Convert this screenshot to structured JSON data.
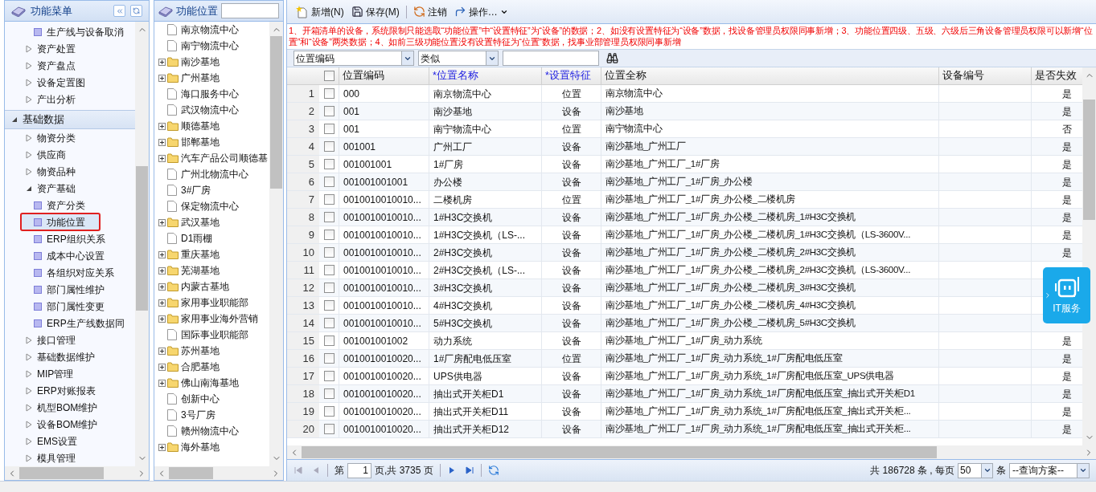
{
  "menu": {
    "title": "功能菜单",
    "items": [
      {
        "label": "生产线与设备取消",
        "kind": "leaf",
        "selected": false
      },
      {
        "label": "资产处置",
        "kind": "group",
        "expanded": false
      },
      {
        "label": "资产盘点",
        "kind": "group",
        "expanded": false
      },
      {
        "label": "设备定置图",
        "kind": "group",
        "expanded": false
      },
      {
        "label": "产出分析",
        "kind": "group",
        "expanded": false
      }
    ],
    "section": {
      "label": "基础数据",
      "expanded": true,
      "children": [
        {
          "label": "物资分类",
          "kind": "group",
          "expanded": false
        },
        {
          "label": "供应商",
          "kind": "group",
          "expanded": false
        },
        {
          "label": "物资品种",
          "kind": "group",
          "expanded": false
        },
        {
          "label": "资产基础",
          "kind": "group",
          "expanded": true,
          "children": [
            {
              "label": "资产分类",
              "kind": "leaf",
              "selected": false
            },
            {
              "label": "功能位置",
              "kind": "leaf",
              "selected": true
            },
            {
              "label": "ERP组织关系",
              "kind": "leaf",
              "selected": false
            },
            {
              "label": "成本中心设置",
              "kind": "leaf",
              "selected": false
            },
            {
              "label": "各组织对应关系",
              "kind": "leaf",
              "selected": false
            },
            {
              "label": "部门属性维护",
              "kind": "leaf",
              "selected": false
            },
            {
              "label": "部门属性变更",
              "kind": "leaf",
              "selected": false
            },
            {
              "label": "ERP生产线数据同",
              "kind": "leaf",
              "selected": false
            }
          ]
        },
        {
          "label": "接口管理",
          "kind": "group",
          "expanded": false
        },
        {
          "label": "基础数据维护",
          "kind": "group",
          "expanded": false
        },
        {
          "label": "MIP管理",
          "kind": "group",
          "expanded": false
        },
        {
          "label": "ERP对账报表",
          "kind": "group",
          "expanded": false
        },
        {
          "label": "机型BOM维护",
          "kind": "group",
          "expanded": false
        },
        {
          "label": "设备BOM维护",
          "kind": "group",
          "expanded": false
        },
        {
          "label": "EMS设置",
          "kind": "group",
          "expanded": false
        },
        {
          "label": "模具管理",
          "kind": "group",
          "expanded": false
        }
      ]
    }
  },
  "location_tree": {
    "title": "功能位置",
    "nodes": [
      {
        "label": "南京物流中心",
        "kind": "file"
      },
      {
        "label": "南宁物流中心",
        "kind": "file"
      },
      {
        "label": "南沙基地",
        "kind": "folder",
        "expanded": false
      },
      {
        "label": "广州基地",
        "kind": "folder",
        "expanded": false
      },
      {
        "label": "海口服务中心",
        "kind": "file"
      },
      {
        "label": "武汉物流中心",
        "kind": "file"
      },
      {
        "label": "顺德基地",
        "kind": "folder",
        "expanded": false
      },
      {
        "label": "邯郸基地",
        "kind": "folder",
        "expanded": false
      },
      {
        "label": "汽车产品公司顺德基",
        "kind": "folder",
        "expanded": false
      },
      {
        "label": "广州北物流中心",
        "kind": "file"
      },
      {
        "label": "3#厂房",
        "kind": "file"
      },
      {
        "label": "保定物流中心",
        "kind": "file"
      },
      {
        "label": "武汉基地",
        "kind": "folder",
        "expanded": false
      },
      {
        "label": "D1雨棚",
        "kind": "file"
      },
      {
        "label": "重庆基地",
        "kind": "folder",
        "expanded": false
      },
      {
        "label": "芜湖基地",
        "kind": "folder",
        "expanded": false
      },
      {
        "label": "内蒙古基地",
        "kind": "folder",
        "expanded": false
      },
      {
        "label": "家用事业职能部",
        "kind": "folder",
        "expanded": false
      },
      {
        "label": "家用事业海外营销",
        "kind": "folder",
        "expanded": false
      },
      {
        "label": "国际事业职能部",
        "kind": "file"
      },
      {
        "label": "苏州基地",
        "kind": "folder",
        "expanded": false
      },
      {
        "label": "合肥基地",
        "kind": "folder",
        "expanded": false
      },
      {
        "label": "佛山南海基地",
        "kind": "folder",
        "expanded": false
      },
      {
        "label": "创新中心",
        "kind": "file"
      },
      {
        "label": "3号厂房",
        "kind": "file"
      },
      {
        "label": "赣州物流中心",
        "kind": "file"
      },
      {
        "label": "海外基地",
        "kind": "folder",
        "expanded": false
      }
    ]
  },
  "toolbar": [
    {
      "label": "新增(N)",
      "kind": "new"
    },
    {
      "label": "保存(M)",
      "kind": "save"
    },
    {
      "label": "注销",
      "kind": "cancel"
    },
    {
      "label": "操作…",
      "kind": "menu"
    }
  ],
  "notice": "1、开箱清单的设备，系统限制只能选取“功能位置”中“设置特征”为“设备”的数据；2、如没有设置特征为“设备”数据，找设备管理员权限同事新增；3、功能位置四级、五级、六级后三角设备管理员权限可以新增“位置”和“设备”两类数据；4、如前三级功能位置没有设置特征为“位置”数据，找事业部管理员权限同事新增",
  "filter": {
    "field": "位置编码",
    "operator": "类似"
  },
  "table": {
    "all_checked": false,
    "columns": [
      {
        "label": "位置编码",
        "required": false
      },
      {
        "label": "*位置名称",
        "required": true
      },
      {
        "label": "*设置特征",
        "required": true
      },
      {
        "label": "位置全称",
        "required": false
      },
      {
        "label": "设备编号",
        "required": false
      },
      {
        "label": "是否失效",
        "required": false
      }
    ],
    "rows": [
      {
        "no": "1",
        "checked": false,
        "code": "000",
        "name": "南京物流中心",
        "feature": "位置",
        "full_name": "南京物流中心",
        "invalid": "是"
      },
      {
        "no": "2",
        "checked": false,
        "code": "001",
        "name": "南沙基地",
        "feature": "设备",
        "full_name": "南沙基地",
        "invalid": "是"
      },
      {
        "no": "3",
        "checked": false,
        "code": "001",
        "name": "南宁物流中心",
        "feature": "位置",
        "full_name": "南宁物流中心",
        "invalid": "否"
      },
      {
        "no": "4",
        "checked": false,
        "code": "001001",
        "name": "广州工厂",
        "feature": "设备",
        "full_name": "南沙基地_广州工厂",
        "invalid": "是"
      },
      {
        "no": "5",
        "checked": false,
        "code": "001001001",
        "name": "1#厂房",
        "feature": "设备",
        "full_name": "南沙基地_广州工厂_1#厂房",
        "invalid": "是"
      },
      {
        "no": "6",
        "checked": false,
        "code": "001001001001",
        "name": "办公楼",
        "feature": "设备",
        "full_name": "南沙基地_广州工厂_1#厂房_办公楼",
        "invalid": "是"
      },
      {
        "no": "7",
        "checked": false,
        "code": "0010010010010...",
        "name": "二楼机房",
        "feature": "位置",
        "full_name": "南沙基地_广州工厂_1#厂房_办公楼_二楼机房",
        "invalid": "是"
      },
      {
        "no": "8",
        "checked": false,
        "code": "0010010010010...",
        "name": "1#H3C交换机",
        "feature": "设备",
        "full_name": "南沙基地_广州工厂_1#厂房_办公楼_二楼机房_1#H3C交换机",
        "invalid": "是"
      },
      {
        "no": "9",
        "checked": false,
        "code": "0010010010010...",
        "name": "1#H3C交换机（LS-...",
        "feature": "设备",
        "full_name": "南沙基地_广州工厂_1#厂房_办公楼_二楼机房_1#H3C交换机（LS-3600V...",
        "invalid": "是"
      },
      {
        "no": "10",
        "checked": false,
        "code": "0010010010010...",
        "name": "2#H3C交换机",
        "feature": "设备",
        "full_name": "南沙基地_广州工厂_1#厂房_办公楼_二楼机房_2#H3C交换机",
        "invalid": "是"
      },
      {
        "no": "11",
        "checked": false,
        "code": "0010010010010...",
        "name": "2#H3C交换机（LS-...",
        "feature": "设备",
        "full_name": "南沙基地_广州工厂_1#厂房_办公楼_二楼机房_2#H3C交换机（LS-3600V..."
      },
      {
        "no": "12",
        "checked": false,
        "code": "0010010010010...",
        "name": "3#H3C交换机",
        "feature": "设备",
        "full_name": "南沙基地_广州工厂_1#厂房_办公楼_二楼机房_3#H3C交换机"
      },
      {
        "no": "13",
        "checked": false,
        "code": "0010010010010...",
        "name": "4#H3C交换机",
        "feature": "设备",
        "full_name": "南沙基地_广州工厂_1#厂房_办公楼_二楼机房_4#H3C交换机"
      },
      {
        "no": "14",
        "checked": false,
        "code": "0010010010010...",
        "name": "5#H3C交换机",
        "feature": "设备",
        "full_name": "南沙基地_广州工厂_1#厂房_办公楼_二楼机房_5#H3C交换机"
      },
      {
        "no": "15",
        "checked": false,
        "code": "001001001002",
        "name": "动力系统",
        "feature": "设备",
        "full_name": "南沙基地_广州工厂_1#厂房_动力系统",
        "invalid": "是"
      },
      {
        "no": "16",
        "checked": false,
        "code": "0010010010020...",
        "name": "1#厂房配电低压室",
        "feature": "位置",
        "full_name": "南沙基地_广州工厂_1#厂房_动力系统_1#厂房配电低压室",
        "invalid": "是"
      },
      {
        "no": "17",
        "checked": false,
        "code": "0010010010020...",
        "name": "UPS供电器",
        "feature": "设备",
        "full_name": "南沙基地_广州工厂_1#厂房_动力系统_1#厂房配电低压室_UPS供电器",
        "invalid": "是"
      },
      {
        "no": "18",
        "checked": false,
        "code": "0010010010020...",
        "name": "抽出式开关柜D1",
        "feature": "设备",
        "full_name": "南沙基地_广州工厂_1#厂房_动力系统_1#厂房配电低压室_抽出式开关柜D1",
        "invalid": "是"
      },
      {
        "no": "19",
        "checked": false,
        "code": "0010010010020...",
        "name": "抽出式开关柜D11",
        "feature": "设备",
        "full_name": "南沙基地_广州工厂_1#厂房_动力系统_1#厂房配电低压室_抽出式开关柜...",
        "invalid": "是"
      },
      {
        "no": "20",
        "checked": false,
        "code": "0010010010020...",
        "name": "抽出式开关柜D12",
        "feature": "设备",
        "full_name": "南沙基地_广州工厂_1#厂房_动力系统_1#厂房配电低压室_抽出式开关柜...",
        "invalid": "是"
      }
    ]
  },
  "pager": {
    "page_prefix": "第",
    "page": "1",
    "page_suffix": "页,共 3735 页",
    "total": "共 186728 条 , 每页",
    "page_size": "50",
    "size_suffix": "条",
    "scheme": "--查询方案--"
  },
  "service_widget": {
    "label": "IT服务"
  }
}
